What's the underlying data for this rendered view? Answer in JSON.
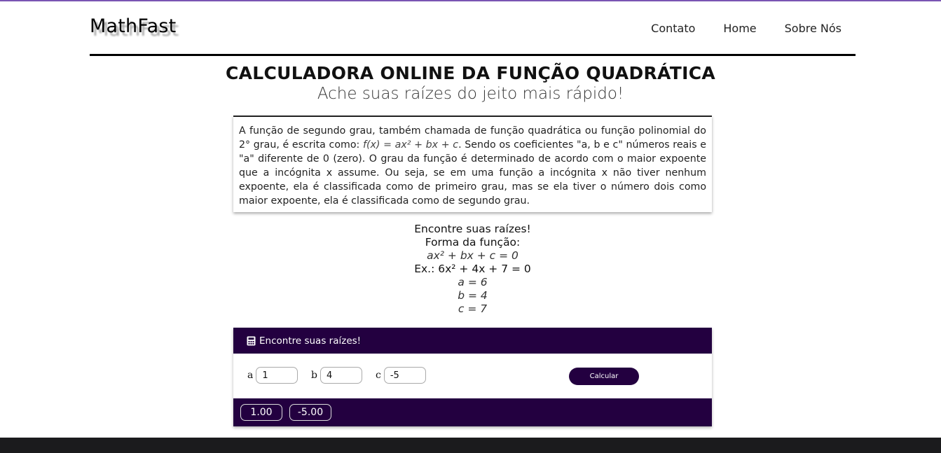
{
  "header": {
    "logo": "MathFast",
    "nav": [
      "Contato",
      "Home",
      "Sobre Nós"
    ]
  },
  "hero": {
    "title": "CALCULADORA ONLINE DA FUNÇÃO QUADRÁTICA",
    "subtitle": "Ache suas raízes do jeito mais rápido!"
  },
  "intro": {
    "text_before": "A função de segundo grau, também chamada de função quadrática ou função polinomial do 2° grau, é escrita como: ",
    "formula": "f(x) = ax² + bx + c",
    "text_after": ". Sendo os coeficientes \"a, b e c\" números reais e \"a\" diferente de 0 (zero). O grau da função é determinado de acordo com o maior expoente que a incógnita x assume. Ou seja, se em uma função a incógnita x não tiver nenhum expoente, ela é classificada como de primeiro grau, mas se ela tiver o número dois como maior expoente, ela é classificada como de segundo grau."
  },
  "howto": {
    "line1": "Encontre suas raízes!",
    "line2": "Forma da função:",
    "form": "ax² + bx + c = 0",
    "example": "Ex.: 6x² + 4x + 7 = 0",
    "a": "a = 6",
    "b": "b = 4",
    "c": "c = 7"
  },
  "calculator": {
    "header": "Encontre suas raízes!",
    "icon": "calculator-icon",
    "label_a": "a",
    "label_b": "b",
    "label_c": "c",
    "value_a": "1",
    "value_b": "4",
    "value_c": "-5",
    "button": "Calcular",
    "roots": [
      "1.00",
      "-5.00"
    ]
  },
  "colors": {
    "accent": "#230040",
    "top_strip": "#7a55b3",
    "footer": "#1b1b1d"
  }
}
